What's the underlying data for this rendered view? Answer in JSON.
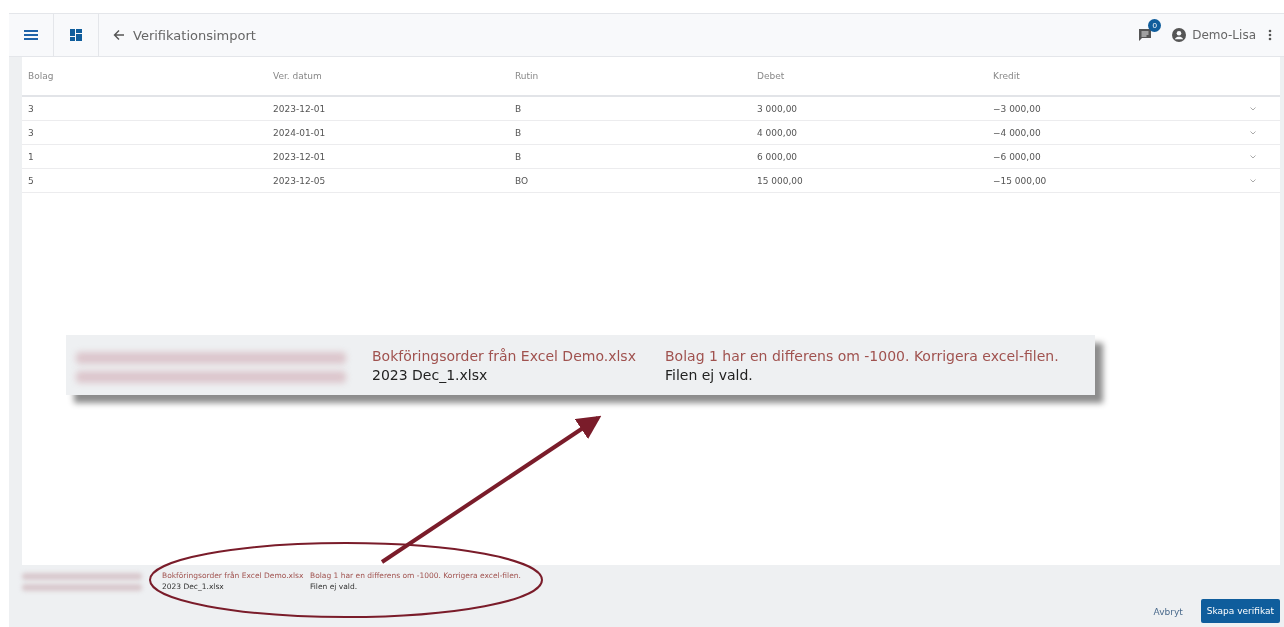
{
  "header": {
    "title": "Verifikationsimport",
    "notification_count": "0",
    "user": "Demo-Lisa"
  },
  "table": {
    "columns": [
      "Bolag",
      "Ver. datum",
      "Rutin",
      "Debet",
      "Kredit"
    ],
    "rows": [
      {
        "cells": [
          "3",
          "2023-12-01",
          "B",
          "3 000,00",
          "−3 000,00"
        ],
        "expanded": false
      },
      {
        "cells": [
          "3",
          "2024-01-01",
          "B",
          "4 000,00",
          "−4 000,00"
        ],
        "expanded": false
      },
      {
        "cells": [
          "1",
          "2023-12-01",
          "B",
          "6 000,00",
          "−6 000,00"
        ],
        "expanded": false
      },
      {
        "cells": [
          "5",
          "2023-12-05",
          "BO",
          "15 000,00",
          "−15 000,00"
        ],
        "expanded": false
      }
    ]
  },
  "callout": {
    "messages": [
      {
        "kind": "error",
        "file": "Bokföringsorder från Excel Demo.xlsx",
        "message": "Bolag 1 har en differens om -1000. Korrigera excel-filen."
      },
      {
        "kind": "info",
        "file": "2023 Dec_1.xlsx",
        "message": "Filen ej vald."
      }
    ]
  },
  "messages": [
    {
      "kind": "error",
      "file": "Bokföringsorder från Excel Demo.xlsx",
      "message": "Bolag 1 har en differens om -1000. Korrigera excel-filen."
    },
    {
      "kind": "info",
      "file": "2023 Dec_1.xlsx",
      "message": "Filen ej vald."
    }
  ],
  "buttons": {
    "cancel": "Avbryt",
    "confirm": "Skapa verifikat"
  }
}
